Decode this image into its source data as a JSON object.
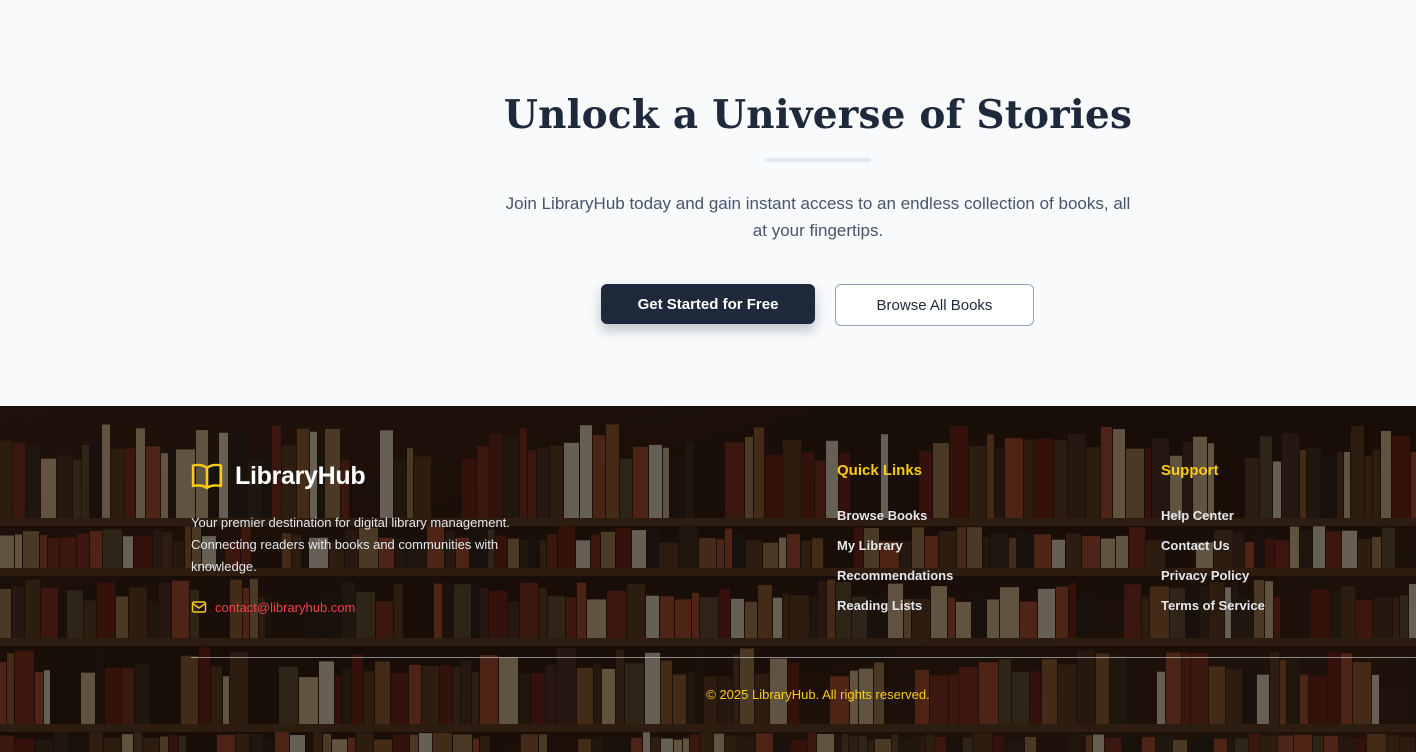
{
  "cta": {
    "title": "Unlock a Universe of Stories",
    "subtitle": "Join LibraryHub today and gain instant access to an endless collection of books, all at your fingertips.",
    "primary_button": "Get Started for Free",
    "secondary_button": "Browse All Books"
  },
  "footer": {
    "brand": {
      "icon": "open-book-icon",
      "name": "LibraryHub",
      "description": "Your premier destination for digital library management. Connecting readers with books and communities with knowledge."
    },
    "contact": {
      "icon": "mail-icon",
      "email": "contact@libraryhub.com"
    },
    "quick_links": {
      "title": "Quick Links",
      "items": [
        "Browse Books",
        "My Library",
        "Recommendations",
        "Reading Lists"
      ]
    },
    "support": {
      "title": "Support",
      "items": [
        "Help Center",
        "Contact Us",
        "Privacy Policy",
        "Terms of Service"
      ]
    },
    "copyright": "© 2025 LibraryHub. All rights reserved."
  },
  "colors": {
    "primary_dark": "#1e293b",
    "accent_yellow": "#facc15",
    "email_red": "#ef4444",
    "page_background": "#f8fafc"
  }
}
